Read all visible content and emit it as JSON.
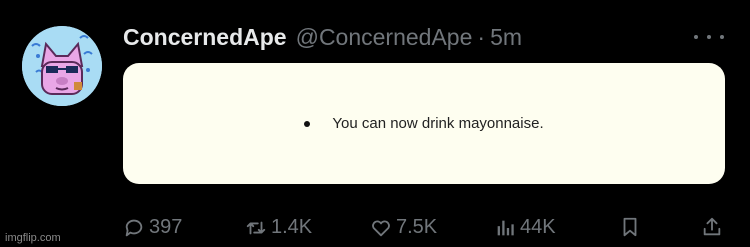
{
  "tweet": {
    "display_name": "ConcernedApe",
    "handle": "@ConcernedApe",
    "separator": "·",
    "time": "5m",
    "media_text": "You can now drink mayonnaise."
  },
  "actions": {
    "replies": "397",
    "retweets": "1.4K",
    "likes": "7.5K",
    "views": "44K"
  },
  "watermark": "imgflip.com",
  "icons": {
    "more": "more-dots-icon",
    "reply": "reply-icon",
    "retweet": "retweet-icon",
    "like": "heart-icon",
    "views": "views-bars-icon",
    "bookmark": "bookmark-icon",
    "share": "share-icon"
  },
  "colors": {
    "background": "#000000",
    "text_primary": "#e7e9ea",
    "text_secondary": "#71767b",
    "media_background": "#fefef0"
  }
}
